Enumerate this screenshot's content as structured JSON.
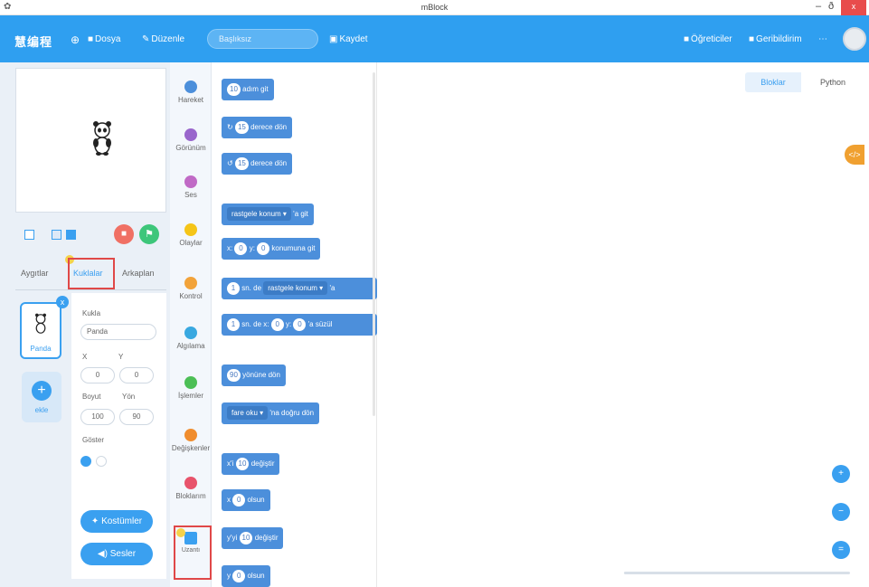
{
  "window": {
    "title": "mBlock",
    "minimize": "–",
    "maximize": "ð",
    "close": "x"
  },
  "menubar": {
    "logo": "慧编程",
    "items": [
      {
        "label": "Dosya",
        "icon": "folder-icon"
      },
      {
        "label": "Düzenle",
        "icon": "wrench-icon"
      }
    ],
    "project_name": "Başlıksız",
    "save_label": "Kaydet",
    "right_items": [
      {
        "label": "Öğreticiler",
        "icon": "book-icon"
      },
      {
        "label": "Geribildirim",
        "icon": "chat-icon"
      }
    ],
    "more": "⋯"
  },
  "stage_tabs": [
    {
      "label": "Aygıtlar",
      "active": false
    },
    {
      "label": "Kuklalar",
      "active": true
    },
    {
      "label": "Arkaplan",
      "active": false
    }
  ],
  "sprites": [
    {
      "name": "Panda",
      "badge": "x"
    }
  ],
  "add_sprite_label": "ekle",
  "sprite_props": {
    "name_label": "Kukla",
    "name_value": "Panda",
    "x_label": "X",
    "x_value": "0",
    "y_label": "Y",
    "y_value": "0",
    "size_label": "Boyut",
    "size_value": "100",
    "direction_label": "Yön",
    "direction_value": "90",
    "show_label": "Göster"
  },
  "panel_buttons": {
    "costumes": "Kostümler",
    "sounds": "Sesler"
  },
  "categories": [
    {
      "label": "Hareket",
      "color": "#4c8fdb"
    },
    {
      "label": "Görünüm",
      "color": "#9966cc"
    },
    {
      "label": "Ses",
      "color": "#c06ac6"
    },
    {
      "label": "Olaylar",
      "color": "#f5c518"
    },
    {
      "label": "Kontrol",
      "color": "#f2a33a"
    },
    {
      "label": "Algılama",
      "color": "#39a8e0"
    },
    {
      "label": "İşlemler",
      "color": "#4cbf56"
    },
    {
      "label": "Değişkenler",
      "color": "#f08d2e"
    },
    {
      "label": "Bloklarım",
      "color": "#e8536b"
    },
    {
      "label": "Uzantı",
      "color": "#3aa0f0"
    }
  ],
  "blocks": [
    {
      "before": "",
      "pill": "10",
      "after": "adım git"
    },
    {
      "before": "↻",
      "pill": "15",
      "after": "derece dön"
    },
    {
      "before": "↺",
      "pill": "15",
      "after": "derece dön"
    },
    {
      "before": "",
      "dd": "rastgele konum ▾",
      "after": "'a git"
    },
    {
      "before": "x:",
      "pill": "0",
      "mid": "y:",
      "pill2": "0",
      "after": "konumuna git"
    },
    {
      "before": "",
      "pill": "1",
      "mid": "sn. de",
      "dd": "rastgele konum ▾",
      "after": "'a"
    },
    {
      "before": "",
      "pill": "1",
      "mid": "sn. de x:",
      "pill2": "0",
      "mid2": "y:",
      "pill3": "0",
      "after": "'a süzül"
    },
    {
      "before": "",
      "pill": "90",
      "after": "yönüne dön"
    },
    {
      "before": "",
      "dd": "fare oku ▾",
      "after": "'na doğru dön"
    },
    {
      "before": "x'i",
      "pill": "10",
      "after": "değiştir"
    },
    {
      "before": "x",
      "pill": "0",
      "after": "olsun"
    },
    {
      "before": "y'yi",
      "pill": "10",
      "after": "değiştir"
    },
    {
      "before": "y",
      "pill": "0",
      "after": "olsun"
    }
  ],
  "mode_tabs": [
    {
      "label": "Bloklar",
      "active": true
    },
    {
      "label": "Python",
      "active": false
    }
  ],
  "code_button": "</>",
  "zoom_buttons": [
    "+",
    "−",
    "="
  ]
}
